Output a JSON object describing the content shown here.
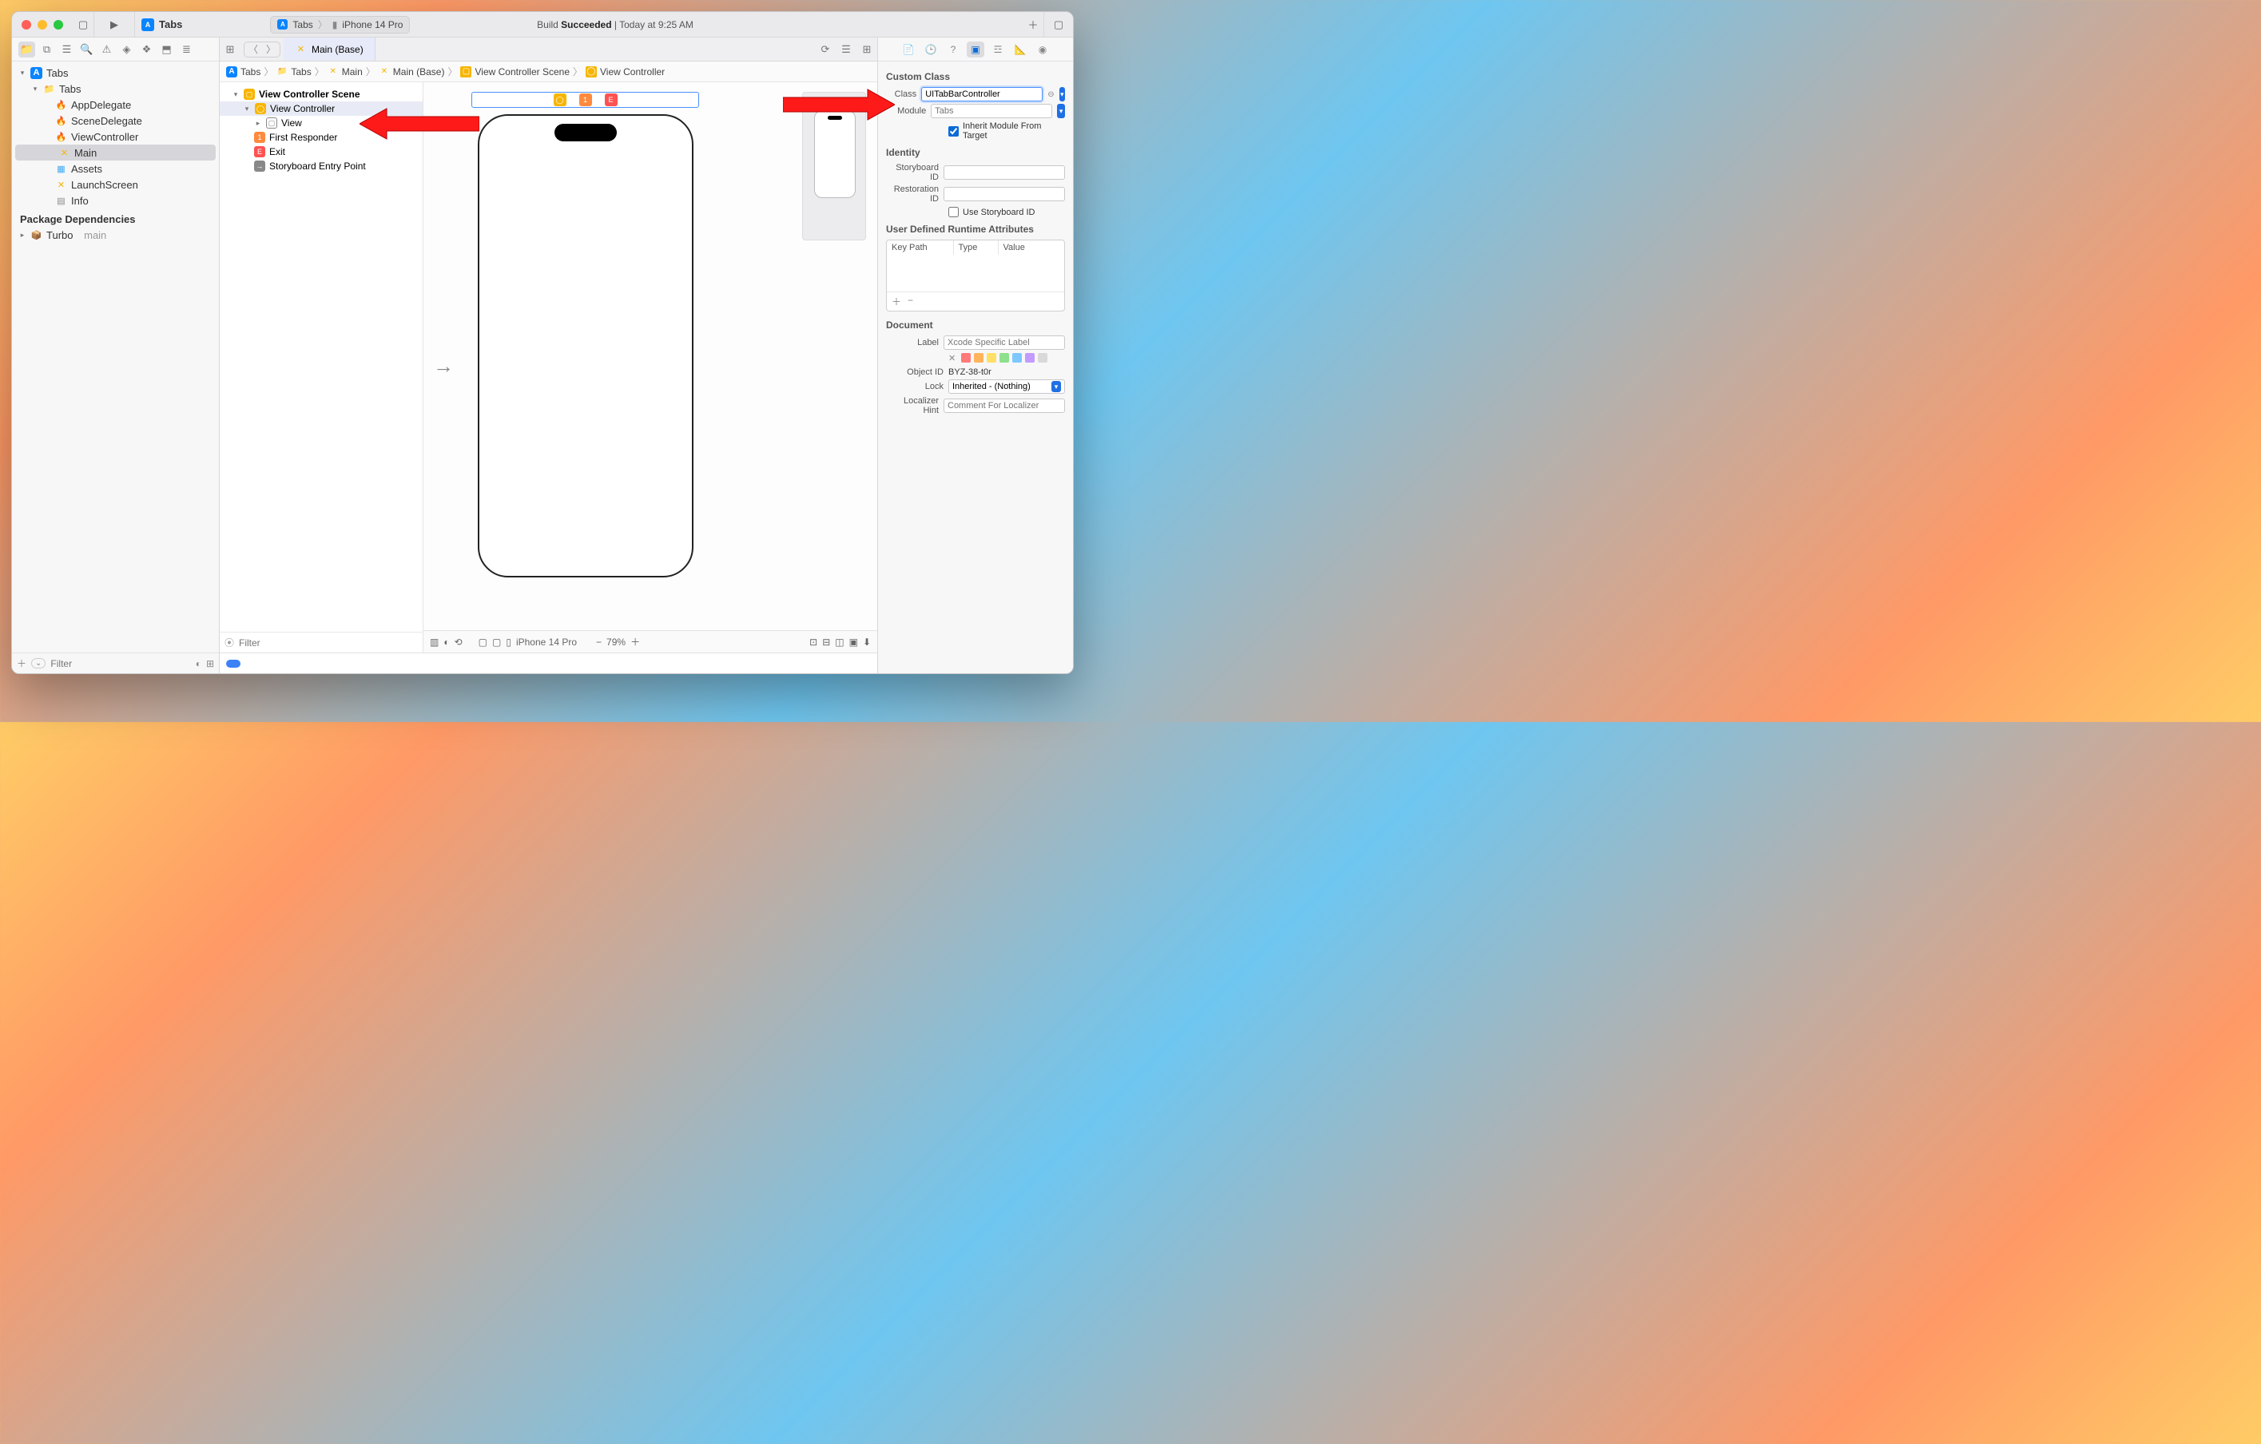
{
  "titlebar": {
    "project": "Tabs"
  },
  "scheme": {
    "target": "Tabs",
    "device": "iPhone 14 Pro"
  },
  "activity": {
    "prefix": "Build ",
    "status": "Succeeded",
    "suffix": " | Today at 9:25 AM"
  },
  "navigator": {
    "root": "Tabs",
    "group": "Tabs",
    "files": {
      "appdelegate": "AppDelegate",
      "scenedelegate": "SceneDelegate",
      "viewcontroller": "ViewController",
      "main": "Main",
      "assets": "Assets",
      "launchscreen": "LaunchScreen",
      "info": "Info"
    },
    "pkgTitle": "Package Dependencies",
    "pkg": {
      "name": "Turbo",
      "branch": "main"
    },
    "filterPlaceholder": "Filter"
  },
  "editor": {
    "tab": "Main (Base)",
    "jump": {
      "p0": "Tabs",
      "p1": "Tabs",
      "p2": "Main",
      "p3": "Main (Base)",
      "p4": "View Controller Scene",
      "p5": "View Controller"
    }
  },
  "outline": {
    "scene": "View Controller Scene",
    "vc": "View Controller",
    "view": "View",
    "first": "First Responder",
    "exit": "Exit",
    "entry": "Storyboard Entry Point",
    "filterPlaceholder": "Filter"
  },
  "canvas": {
    "device": "iPhone 14 Pro",
    "zoom": "79%"
  },
  "inspector": {
    "customClass": {
      "title": "Custom Class",
      "classLabel": "Class",
      "classValue": "UITabBarController",
      "moduleLabel": "Module",
      "modulePlaceholder": "Tabs",
      "inheritLabel": "Inherit Module From Target"
    },
    "identity": {
      "title": "Identity",
      "storyboardIdLabel": "Storyboard ID",
      "restorationIdLabel": "Restoration ID",
      "useStoryboardId": "Use Storyboard ID"
    },
    "udra": {
      "title": "User Defined Runtime Attributes",
      "colKeyPath": "Key Path",
      "colType": "Type",
      "colValue": "Value"
    },
    "document": {
      "title": "Document",
      "labelLabel": "Label",
      "labelPlaceholder": "Xcode Specific Label",
      "objectIdLabel": "Object ID",
      "objectIdValue": "BYZ-38-t0r",
      "lockLabel": "Lock",
      "lockValue": "Inherited - (Nothing)",
      "hintLabel": "Localizer Hint",
      "hintPlaceholder": "Comment For Localizer"
    }
  }
}
